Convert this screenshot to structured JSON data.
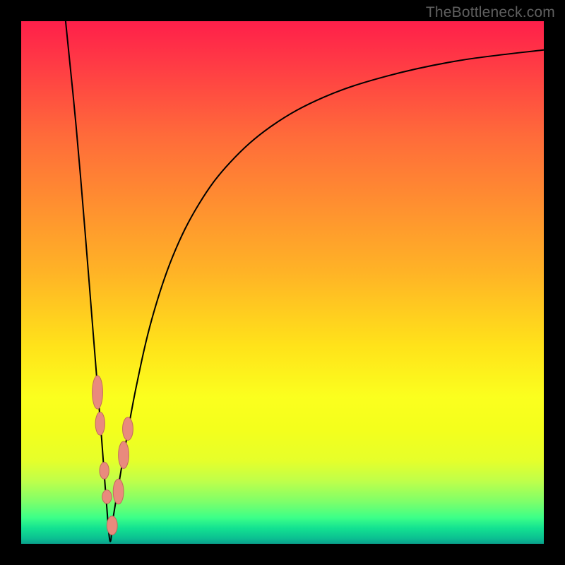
{
  "watermark": "TheBottleneck.com",
  "chart_data": {
    "type": "line",
    "title": "",
    "xlabel": "",
    "ylabel": "",
    "xlim": [
      0,
      100
    ],
    "ylim": [
      0,
      100
    ],
    "vmin_x": 17,
    "series": [
      {
        "name": "curve",
        "points": [
          {
            "x": 8.5,
            "y": 100
          },
          {
            "x": 10.5,
            "y": 80
          },
          {
            "x": 12.2,
            "y": 60
          },
          {
            "x": 13.8,
            "y": 40
          },
          {
            "x": 15.4,
            "y": 20
          },
          {
            "x": 16.3,
            "y": 8
          },
          {
            "x": 17,
            "y": 0.5
          },
          {
            "x": 17.6,
            "y": 5
          },
          {
            "x": 18.6,
            "y": 11
          },
          {
            "x": 19.8,
            "y": 18
          },
          {
            "x": 22,
            "y": 30
          },
          {
            "x": 25,
            "y": 43
          },
          {
            "x": 29,
            "y": 55
          },
          {
            "x": 34,
            "y": 65
          },
          {
            "x": 40,
            "y": 73
          },
          {
            "x": 48,
            "y": 80
          },
          {
            "x": 58,
            "y": 85.5
          },
          {
            "x": 70,
            "y": 89.5
          },
          {
            "x": 84,
            "y": 92.5
          },
          {
            "x": 100,
            "y": 94.5
          }
        ]
      }
    ],
    "markers": [
      {
        "x": 14.6,
        "y": 29,
        "rx": 1.0,
        "ry": 3.2
      },
      {
        "x": 15.1,
        "y": 23,
        "rx": 0.9,
        "ry": 2.2
      },
      {
        "x": 15.9,
        "y": 14,
        "rx": 0.9,
        "ry": 1.6
      },
      {
        "x": 16.4,
        "y": 9,
        "rx": 0.9,
        "ry": 1.3
      },
      {
        "x": 17.4,
        "y": 3.5,
        "rx": 1.0,
        "ry": 1.8
      },
      {
        "x": 18.6,
        "y": 10,
        "rx": 1.0,
        "ry": 2.4
      },
      {
        "x": 19.6,
        "y": 17,
        "rx": 1.0,
        "ry": 2.6
      },
      {
        "x": 20.4,
        "y": 22,
        "rx": 1.0,
        "ry": 2.2
      }
    ]
  }
}
